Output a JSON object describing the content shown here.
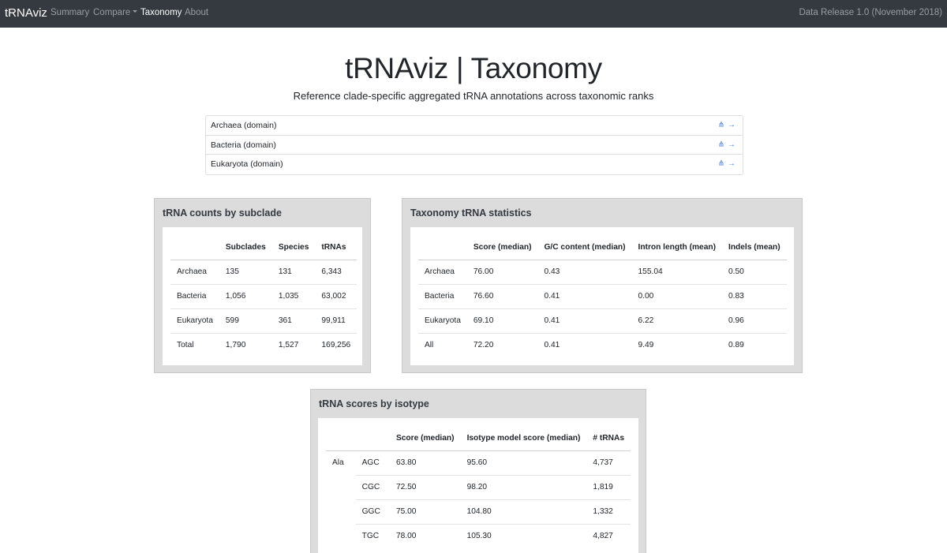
{
  "navbar": {
    "brand": "tRNAviz",
    "links": [
      {
        "label": "Summary",
        "active": false
      },
      {
        "label": "Compare",
        "active": false,
        "dropdown": true
      },
      {
        "label": "Taxonomy",
        "active": true
      },
      {
        "label": "About",
        "active": false
      }
    ],
    "release": "Data Release 1.0 (November 2018)"
  },
  "header": {
    "title": "tRNAviz | Taxonomy",
    "subtitle": "Reference clade-specific aggregated tRNA annotations across taxonomic ranks"
  },
  "domains": [
    {
      "label": "Archaea (domain)",
      "icons": [
        "tree-icon",
        "arrow-right-icon"
      ]
    },
    {
      "label": "Bacteria (domain)",
      "icons": [
        "tree-icon",
        "arrow-right-icon"
      ]
    },
    {
      "label": "Eukaryota (domain)",
      "icons": [
        "tree-icon",
        "arrow-right-icon"
      ]
    }
  ],
  "icons": {
    "tree": "⋔",
    "arrow": "→"
  },
  "subclade_card": {
    "title": "tRNA counts by subclade",
    "headers": [
      "",
      "Subclades",
      "Species",
      "tRNAs"
    ],
    "rows": [
      [
        "Archaea",
        "135",
        "131",
        "6,343"
      ],
      [
        "Bacteria",
        "1,056",
        "1,035",
        "63,002"
      ],
      [
        "Eukaryota",
        "599",
        "361",
        "99,911"
      ],
      [
        "Total",
        "1,790",
        "1,527",
        "169,256"
      ]
    ]
  },
  "stats_card": {
    "title": "Taxonomy tRNA statistics",
    "headers": [
      "",
      "Score (median)",
      "G/C content (median)",
      "Intron length (mean)",
      "Indels (mean)"
    ],
    "rows": [
      [
        "Archaea",
        "76.00",
        "0.43",
        "155.04",
        "0.50"
      ],
      [
        "Bacteria",
        "76.60",
        "0.41",
        "0.00",
        "0.83"
      ],
      [
        "Eukaryota",
        "69.10",
        "0.41",
        "6.22",
        "0.96"
      ],
      [
        "All",
        "72.20",
        "0.41",
        "9.49",
        "0.89"
      ]
    ]
  },
  "isotype_card": {
    "title": "tRNA scores by isotype",
    "headers": [
      "",
      "",
      "Score (median)",
      "Isotype model score (median)",
      "# tRNAs"
    ],
    "isotype": "Ala",
    "rows": [
      [
        "AGC",
        "63.80",
        "95.60",
        "4,737"
      ],
      [
        "CGC",
        "72.50",
        "98.20",
        "1,819"
      ],
      [
        "GGC",
        "75.00",
        "104.80",
        "1,332"
      ],
      [
        "TGC",
        "78.00",
        "105.30",
        "4,827"
      ]
    ]
  },
  "colors": {
    "navbar": "#343a40",
    "card": "#dcdcdc",
    "link": "#3e7bd6"
  }
}
